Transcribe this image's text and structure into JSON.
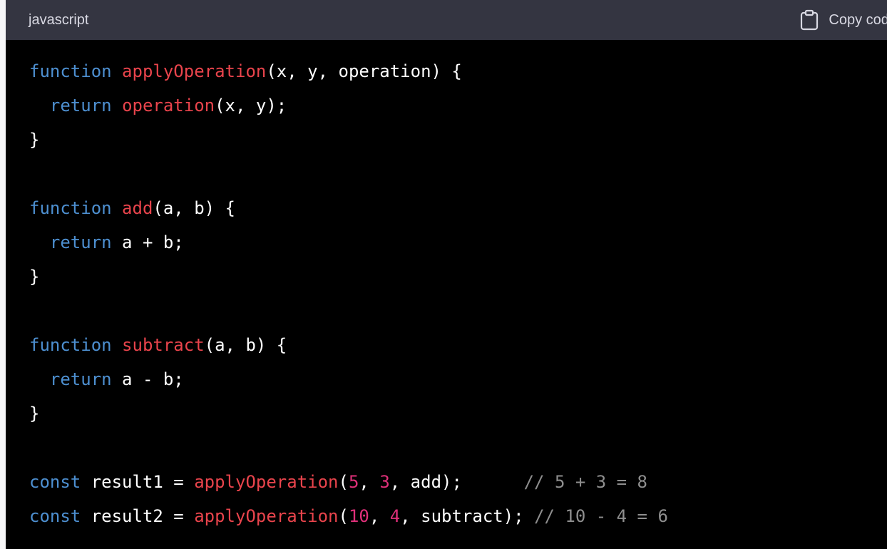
{
  "header": {
    "language": "javascript",
    "copy_label": "Copy code",
    "copy_icon": "clipboard-icon"
  },
  "code": {
    "lines": [
      [
        {
          "t": "kw",
          "v": "function"
        },
        {
          "t": "pl",
          "v": " "
        },
        {
          "t": "fn",
          "v": "applyOperation"
        },
        {
          "t": "pl",
          "v": "(x, y, operation) {"
        }
      ],
      [
        {
          "t": "pl",
          "v": "  "
        },
        {
          "t": "kw",
          "v": "return"
        },
        {
          "t": "pl",
          "v": " "
        },
        {
          "t": "fn",
          "v": "operation"
        },
        {
          "t": "pl",
          "v": "(x, y);"
        }
      ],
      [
        {
          "t": "pl",
          "v": "}"
        }
      ],
      [],
      [
        {
          "t": "kw",
          "v": "function"
        },
        {
          "t": "pl",
          "v": " "
        },
        {
          "t": "fn",
          "v": "add"
        },
        {
          "t": "pl",
          "v": "(a, b) {"
        }
      ],
      [
        {
          "t": "pl",
          "v": "  "
        },
        {
          "t": "kw",
          "v": "return"
        },
        {
          "t": "pl",
          "v": " a + b;"
        }
      ],
      [
        {
          "t": "pl",
          "v": "}"
        }
      ],
      [],
      [
        {
          "t": "kw",
          "v": "function"
        },
        {
          "t": "pl",
          "v": " "
        },
        {
          "t": "fn",
          "v": "subtract"
        },
        {
          "t": "pl",
          "v": "(a, b) {"
        }
      ],
      [
        {
          "t": "pl",
          "v": "  "
        },
        {
          "t": "kw",
          "v": "return"
        },
        {
          "t": "pl",
          "v": " a - b;"
        }
      ],
      [
        {
          "t": "pl",
          "v": "}"
        }
      ],
      [],
      [
        {
          "t": "kw",
          "v": "const"
        },
        {
          "t": "pl",
          "v": " result1 = "
        },
        {
          "t": "fn",
          "v": "applyOperation"
        },
        {
          "t": "pl",
          "v": "("
        },
        {
          "t": "num",
          "v": "5"
        },
        {
          "t": "pl",
          "v": ", "
        },
        {
          "t": "num",
          "v": "3"
        },
        {
          "t": "pl",
          "v": ", add);      "
        },
        {
          "t": "cm",
          "v": "// 5 + 3 = 8"
        }
      ],
      [
        {
          "t": "kw",
          "v": "const"
        },
        {
          "t": "pl",
          "v": " result2 = "
        },
        {
          "t": "fn",
          "v": "applyOperation"
        },
        {
          "t": "pl",
          "v": "("
        },
        {
          "t": "num",
          "v": "10"
        },
        {
          "t": "pl",
          "v": ", "
        },
        {
          "t": "num",
          "v": "4"
        },
        {
          "t": "pl",
          "v": ", subtract); "
        },
        {
          "t": "cm",
          "v": "// 10 - 4 = 6"
        }
      ]
    ]
  },
  "colors": {
    "header_bg": "#343541",
    "code_bg": "#000000",
    "keyword": "#4d8fd0",
    "function": "#e9444c",
    "number": "#df3079",
    "comment": "#8e8e8e",
    "plain": "#ffffff"
  }
}
